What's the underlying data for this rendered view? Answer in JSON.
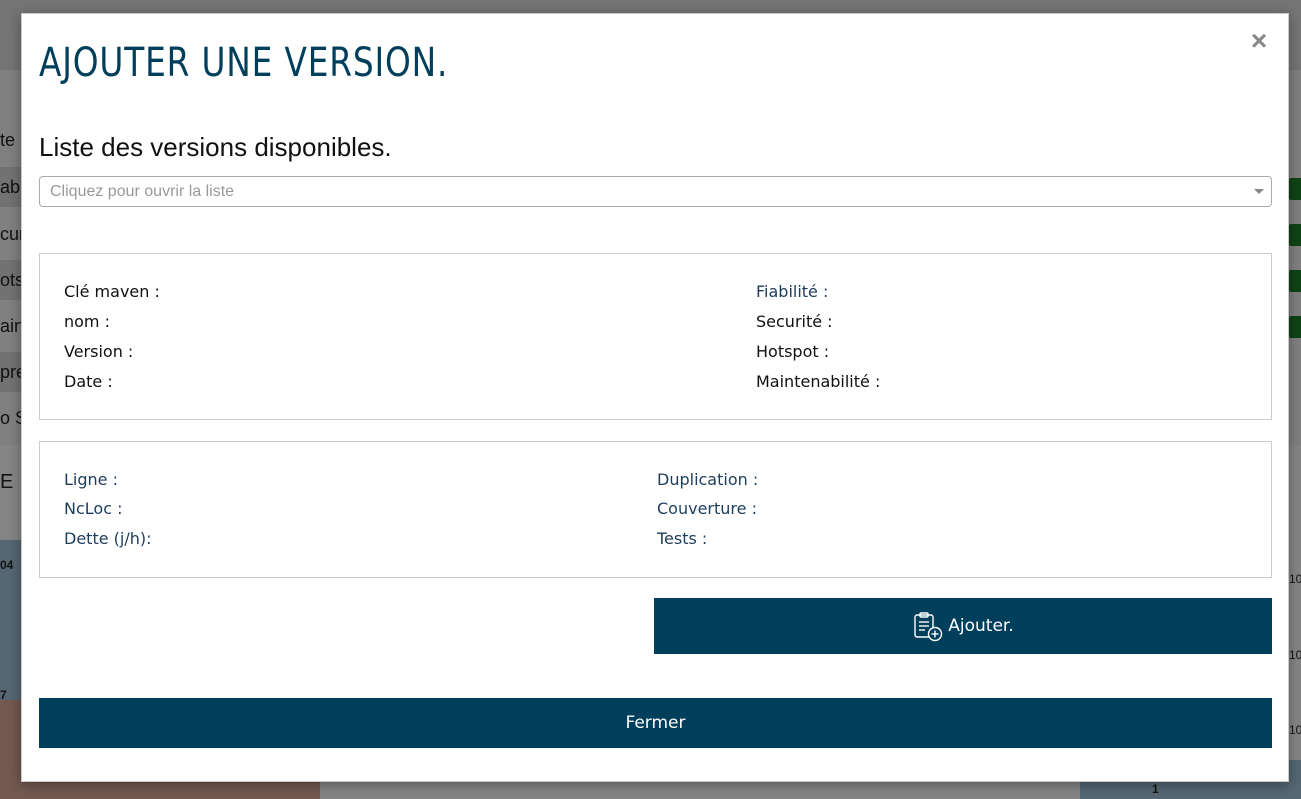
{
  "modal": {
    "title": "AJOUTER UNE VERSION.",
    "close_glyph": "×"
  },
  "version_list": {
    "title": "Liste des versions disponibles.",
    "placeholder": "Cliquez pour ouvrir la liste"
  },
  "details": {
    "left": [
      "Clé maven :",
      "nom :",
      "Version :",
      "Date :"
    ],
    "right": [
      "Fiabilité :",
      "Securité :",
      "Hotspot :",
      "Maintenabilité :"
    ]
  },
  "metrics": {
    "left": [
      "Ligne :",
      "NcLoc :",
      "Dette (j/h):"
    ],
    "right": [
      "Duplication :",
      "Couverture :",
      "Tests :"
    ]
  },
  "buttons": {
    "add_label": "Ajouter.",
    "close_label": "Fermer"
  },
  "icons": {
    "add_icon": "clipboard-add-icon",
    "close_icon": "close-icon",
    "dropdown_icon": "chevron-down-icon"
  },
  "background": {
    "row_fragments": [
      "te",
      "abil",
      "cur",
      "otsp",
      "ain",
      "pre",
      "o So"
    ],
    "section_fragment": "E",
    "tick_labels": [
      "04",
      "7",
      "1",
      "10",
      "10",
      "10"
    ]
  },
  "colors": {
    "primary": "#003f5c",
    "title": "#003f5c",
    "blue_label": "#1d3d5c",
    "badge_green": "#1d7a28"
  }
}
